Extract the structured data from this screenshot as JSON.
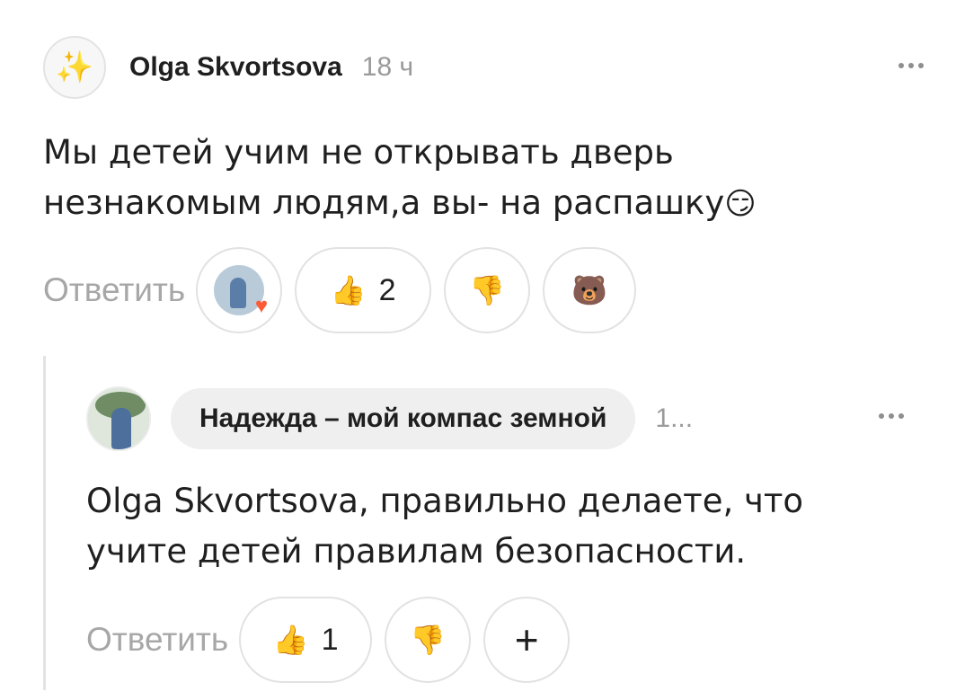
{
  "comment": {
    "author": "Olga Skvortsova",
    "avatar_emoji": "✨",
    "time": "18 ч",
    "text_line1": "Мы детей учим не открывать дверь",
    "text_line2": "незнакомым людям,а вы- на распашку",
    "text_emoji": "😏",
    "reply_label": "Ответить",
    "reactions": {
      "reacted_icon": "user-avatar-heart-icon",
      "heart": "♥",
      "like_emoji": "👍",
      "like_count": "2",
      "dislike_emoji": "👎",
      "bear_emoji": "🐻"
    }
  },
  "reply": {
    "author": "Надежда – мой компас земной",
    "time": "1...",
    "text_line1": "Olga Skvortsova, правильно делаете, что",
    "text_line2": "учите детей правилам безопасности.",
    "reply_label": "Ответить",
    "reactions": {
      "like_emoji": "👍",
      "like_count": "1",
      "dislike_emoji": "👎",
      "add_symbol": "+"
    }
  },
  "colors": {
    "text": "#1f1f1f",
    "muted": "#9a9a9a",
    "reply_label": "#a7a7a7",
    "border": "#e2e2e2",
    "chip": "#efefef"
  }
}
